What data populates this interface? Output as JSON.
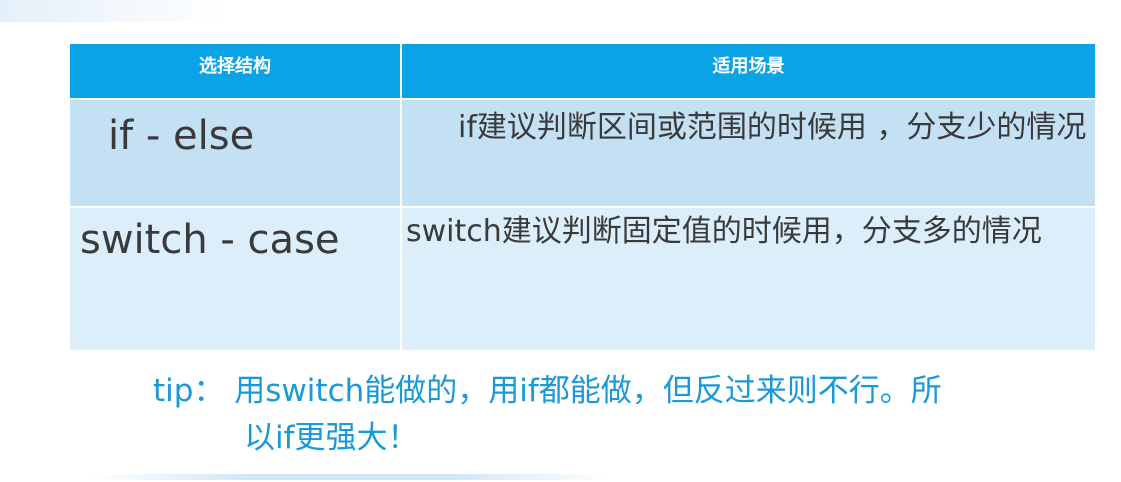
{
  "table": {
    "headers": {
      "structure": "选择结构",
      "scenario": "适用场景"
    },
    "rows": [
      {
        "structure": "if - else",
        "scenario": "if建议判断区间或范围的时候用 ，分支少的情况"
      },
      {
        "structure": "switch - case",
        "scenario": "switch建议判断固定值的时候用，分支多的情况"
      }
    ]
  },
  "tip": {
    "line1": "tip： 用switch能做的，用if都能做，但反过来则不行。所",
    "line2": "以if更强大！"
  },
  "colors": {
    "header_bg": "#0aa3e6",
    "row_odd_bg": "#c4e0f3",
    "row_even_bg": "#dceef9",
    "tip_text": "#1a99d8"
  }
}
